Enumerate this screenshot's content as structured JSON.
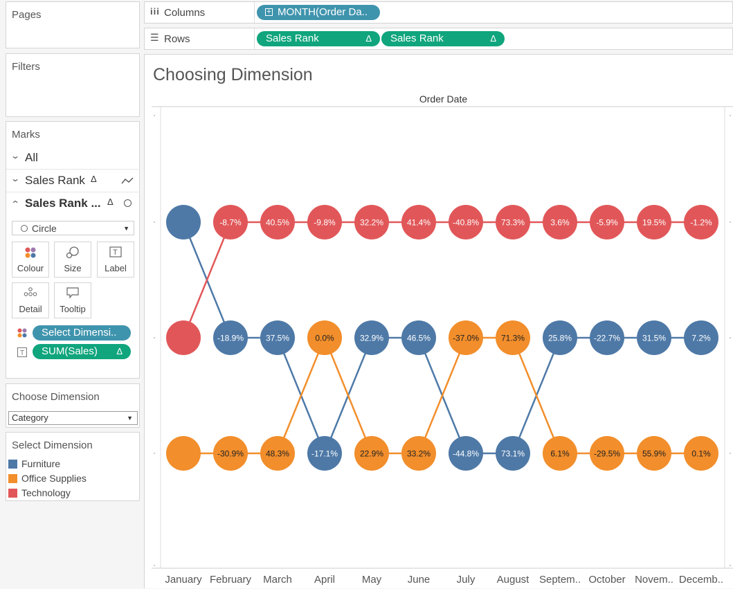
{
  "shelves": {
    "pages": {
      "title": "Pages"
    },
    "filters": {
      "title": "Filters"
    },
    "columns": {
      "label": "Columns",
      "pill": "MONTH(Order Da.."
    },
    "rows": {
      "label": "Rows",
      "pills": [
        "Sales Rank",
        "Sales Rank"
      ],
      "delta": "Δ"
    }
  },
  "marks": {
    "title": "Marks",
    "all_label": "All",
    "layer1_label": "Sales Rank",
    "layer1_delta": "Δ",
    "layer2_label": "Sales Rank ...",
    "layer2_delta": "Δ",
    "mark_type": "Circle",
    "buttons": {
      "colour": "Colour",
      "size": "Size",
      "label": "Label",
      "detail": "Detail",
      "tooltip": "Tooltip"
    },
    "field_colour": "Select Dimensi..",
    "field_label": "SUM(Sales)",
    "field_label_delta": "Δ"
  },
  "parameter": {
    "title": "Choose Dimension",
    "value": "Category"
  },
  "legend": {
    "title": "Select Dimension",
    "items": [
      {
        "name": "Furniture",
        "color": "#4e79a7"
      },
      {
        "name": "Office Supplies",
        "color": "#f28e2b"
      },
      {
        "name": "Technology",
        "color": "#e15759"
      }
    ]
  },
  "view": {
    "title": "Choosing Dimension",
    "column_header": "Order Date"
  },
  "chart_data": {
    "type": "line",
    "title": "Choosing Dimension",
    "xlabel": "Order Date",
    "ylabel": "",
    "categories": [
      "January",
      "February",
      "March",
      "April",
      "May",
      "June",
      "July",
      "August",
      "Septem..",
      "October",
      "Novem..",
      "Decemb.."
    ],
    "rank_axis": [
      1,
      3
    ],
    "series": [
      {
        "name": "Furniture",
        "color": "#4e79a7",
        "ranks": [
          1,
          2,
          2,
          3,
          2,
          2,
          3,
          3,
          2,
          2,
          2,
          2
        ],
        "labels": [
          "",
          "-18.9%",
          "37.5%",
          "-17.1%",
          "32.9%",
          "46.5%",
          "-44.8%",
          "73.1%",
          "25.8%",
          "-22.7%",
          "31.5%",
          "7.2%"
        ]
      },
      {
        "name": "Office Supplies",
        "color": "#f28e2b",
        "ranks": [
          3,
          3,
          3,
          2,
          3,
          3,
          2,
          2,
          3,
          3,
          3,
          3
        ],
        "labels": [
          "",
          "-30.9%",
          "48.3%",
          "0.0%",
          "22.9%",
          "33.2%",
          "-37.0%",
          "71.3%",
          "6.1%",
          "-29.5%",
          "55.9%",
          "0.1%"
        ]
      },
      {
        "name": "Technology",
        "color": "#e15759",
        "ranks": [
          2,
          1,
          1,
          1,
          1,
          1,
          1,
          1,
          1,
          1,
          1,
          1
        ],
        "labels": [
          "",
          "-8.7%",
          "40.5%",
          "-9.8%",
          "32.2%",
          "41.4%",
          "-40.8%",
          "73.3%",
          "3.6%",
          "-5.9%",
          "19.5%",
          "-1.2%"
        ]
      }
    ]
  }
}
